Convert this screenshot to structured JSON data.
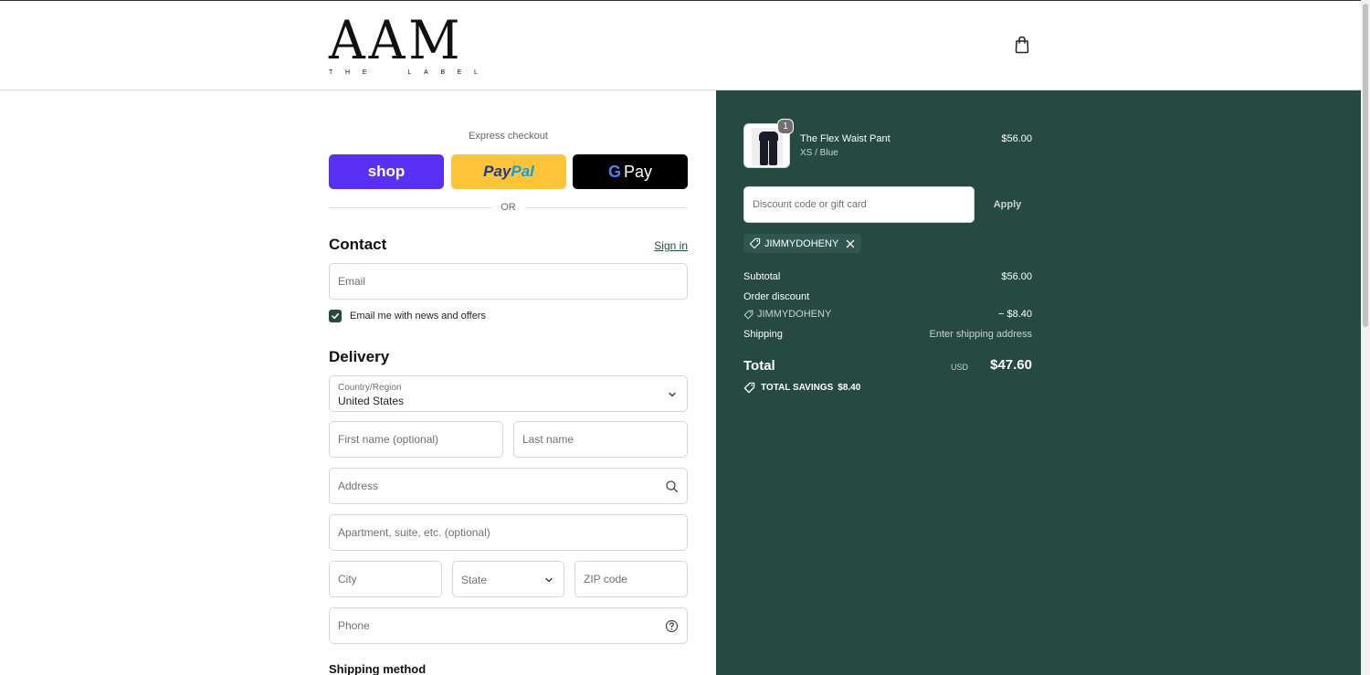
{
  "brand": {
    "logo_main": "AAM",
    "logo_sub": [
      "T",
      "H",
      "E",
      "",
      "L",
      "A",
      "B",
      "E",
      "L"
    ],
    "logo_sub_text": "THE LABEL"
  },
  "header": {
    "cart_icon": "shopping-bag-icon"
  },
  "express": {
    "label": "Express checkout",
    "shop_label": "shop",
    "paypal_label_1": "Pay",
    "paypal_label_2": "Pal",
    "gpay_g": "G",
    "gpay_label": "Pay",
    "or_label": "OR"
  },
  "contact": {
    "title": "Contact",
    "signin_label": "Sign in",
    "email_placeholder": "Email",
    "newsletter_label": "Email me with news and offers",
    "newsletter_checked": true
  },
  "delivery": {
    "title": "Delivery",
    "country_label": "Country/Region",
    "country_value": "United States",
    "first_name_placeholder": "First name (optional)",
    "last_name_placeholder": "Last name",
    "address_placeholder": "Address",
    "apartment_placeholder": "Apartment, suite, etc. (optional)",
    "city_placeholder": "City",
    "state_placeholder": "State",
    "zip_placeholder": "ZIP code",
    "phone_placeholder": "Phone"
  },
  "shipping_method": {
    "title": "Shipping method"
  },
  "order": {
    "item": {
      "name": "The Flex Waist Pant",
      "variant": "XS / Blue",
      "price": "$56.00",
      "quantity": "1"
    },
    "discount_placeholder": "Discount code or gift card",
    "apply_label": "Apply",
    "applied_code": "JIMMYDOHENY",
    "subtotal_label": "Subtotal",
    "subtotal_value": "$56.00",
    "order_discount_label": "Order discount",
    "discount_code": "JIMMYDOHENY",
    "discount_value": "− $8.40",
    "shipping_label": "Shipping",
    "shipping_value": "Enter shipping address",
    "total_label": "Total",
    "currency": "USD",
    "total_value": "$47.60",
    "savings_label": "TOTAL SAVINGS",
    "savings_value": "$8.40"
  },
  "colors": {
    "panel": "#264a42",
    "shop": "#5a31f4",
    "paypal": "#ffc439",
    "gpay": "#000000"
  }
}
